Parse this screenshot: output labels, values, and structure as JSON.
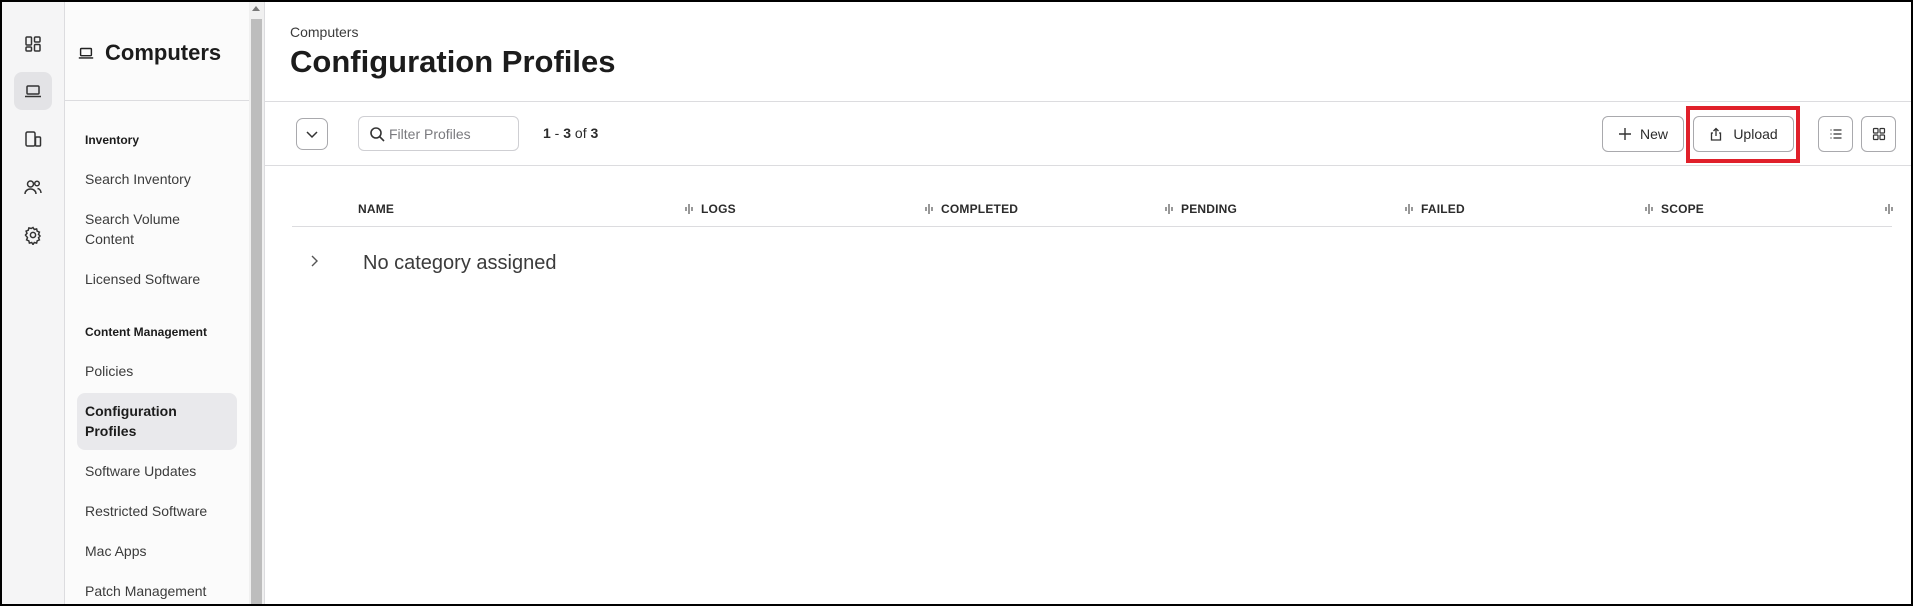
{
  "rail": {
    "items": [
      {
        "icon": "dashboard-icon",
        "active": false
      },
      {
        "icon": "laptop-icon",
        "active": true
      },
      {
        "icon": "devices-icon",
        "active": false
      },
      {
        "icon": "users-icon",
        "active": false
      },
      {
        "icon": "settings-gear-icon",
        "active": false
      }
    ]
  },
  "sidebar": {
    "title": "Computers",
    "sections": [
      {
        "label": "Inventory",
        "items": [
          "Search Inventory",
          "Search Volume Content",
          "Licensed Software"
        ]
      },
      {
        "label": "Content Management",
        "items": [
          "Policies",
          "Configuration Profiles",
          "Software Updates",
          "Restricted Software",
          "Mac Apps",
          "Patch Management"
        ]
      }
    ],
    "active_item": "Configuration Profiles"
  },
  "header": {
    "breadcrumb": "Computers",
    "title": "Configuration Profiles"
  },
  "toolbar": {
    "filter_placeholder": "Filter Profiles",
    "count": {
      "start": "1",
      "sep": " - ",
      "end": "3",
      "of": " of ",
      "total": "3"
    },
    "new_label": "New",
    "upload_label": "Upload"
  },
  "table": {
    "columns": [
      "NAME",
      "LOGS",
      "COMPLETED",
      "PENDING",
      "FAILED",
      "SCOPE"
    ],
    "groups": [
      {
        "label": "No category assigned",
        "expanded": false
      }
    ]
  },
  "colors": {
    "highlight": "#e0202a",
    "active_bg": "#e9e9ec"
  }
}
